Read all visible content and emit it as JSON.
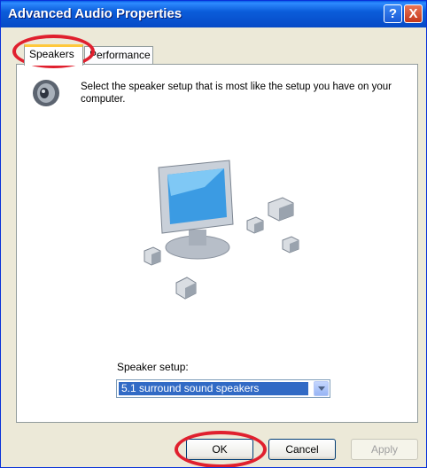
{
  "window": {
    "title": "Advanced Audio Properties"
  },
  "titlebar_buttons": {
    "help": "?",
    "close": "X"
  },
  "tabs": [
    {
      "label": "Speakers",
      "selected": true
    },
    {
      "label": "Performance",
      "selected": false
    }
  ],
  "panel": {
    "intro_text": "Select the speaker setup that is most like the setup you have on your computer.",
    "icon": "speaker-icon",
    "setup_label": "Speaker setup:",
    "setup_value": "5.1 surround sound speakers"
  },
  "buttons": {
    "ok": "OK",
    "cancel": "Cancel",
    "apply": "Apply"
  },
  "annotations": {
    "color": "#E0202E"
  },
  "colors": {
    "titlebar": "#0B5DDA",
    "tab_highlight": "#FFC83C",
    "selection": "#316AC5"
  }
}
